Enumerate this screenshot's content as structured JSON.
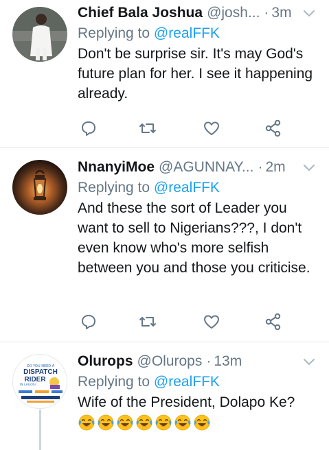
{
  "tweets": [
    {
      "name": "Chief Bala Joshua",
      "handle": "@josh...",
      "dot": "·",
      "time": "3m",
      "replying_prefix": "Replying to ",
      "replying_to": "@realFFK",
      "text": "Don't be surprise sir. It's may God's future plan for her. I see it happening already."
    },
    {
      "name": "NnanyiMoe",
      "handle": "@AGUNNAY...",
      "dot": "·",
      "time": "2m",
      "replying_prefix": "Replying to ",
      "replying_to": "@realFFK",
      "text": "And these the sort of Leader you want to sell to Nigerians???, I don't even know who's more selfish between you and those you criticise."
    },
    {
      "name": "Olurops",
      "handle": "@Olurops",
      "dot": "·",
      "time": "13m",
      "replying_prefix": "Replying to ",
      "replying_to": "@realFFK",
      "text": "Wife of the President, Dolapo Ke?",
      "emoji_count": 7,
      "avatar_poster": {
        "line1": "DO YOU NEED A",
        "line2": "DISPATCH",
        "line3": "RIDER",
        "line4": "IN LAGOS?"
      }
    }
  ],
  "icons": [
    "reply-icon",
    "retweet-icon",
    "like-icon",
    "share-icon",
    "chevron-down-icon"
  ],
  "colors": {
    "name": "#14171a",
    "secondary": "#657786",
    "link": "#1da1f2",
    "divider": "#e1e8ed"
  }
}
